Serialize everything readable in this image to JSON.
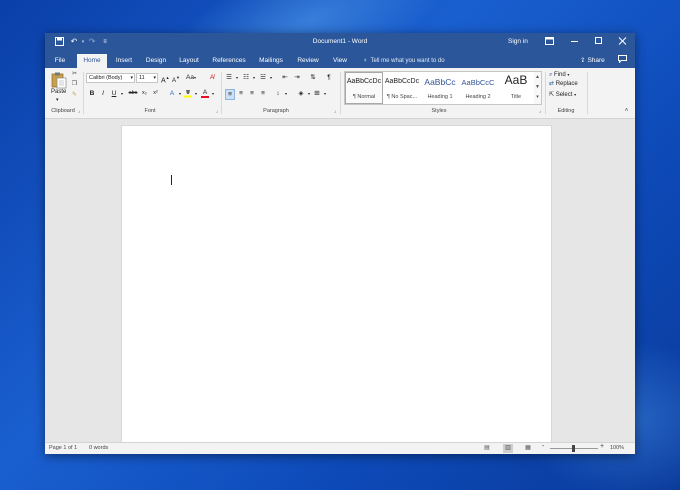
{
  "window": {
    "title": "Document1  -  Word",
    "sign_in": "Sign in"
  },
  "quick_access": {
    "save_icon": "save-icon",
    "undo_icon": "undo-icon",
    "redo_icon": "redo-icon",
    "customize_icon": "customize-icon"
  },
  "tabs": [
    {
      "label": "File"
    },
    {
      "label": "Home"
    },
    {
      "label": "Insert"
    },
    {
      "label": "Design"
    },
    {
      "label": "Layout"
    },
    {
      "label": "References"
    },
    {
      "label": "Mailings"
    },
    {
      "label": "Review"
    },
    {
      "label": "View"
    }
  ],
  "tell_me": "Tell me what you want to do",
  "share": "Share",
  "ribbon": {
    "clipboard": {
      "label": "Clipboard",
      "paste": "Paste"
    },
    "font": {
      "label": "Font",
      "font_name": "Calibri (Body)",
      "font_size": "11",
      "bold": "B",
      "italic": "I",
      "underline": "U",
      "strike": "abc",
      "subscript": "x₂",
      "superscript": "x²",
      "grow": "A",
      "shrink": "A",
      "case": "Aa",
      "font_color": "A"
    },
    "paragraph": {
      "label": "Paragraph",
      "pilcrow": "¶"
    },
    "styles": {
      "label": "Styles",
      "items": [
        {
          "preview": "AaBbCcDc",
          "name": "¶ Normal"
        },
        {
          "preview": "AaBbCcDc",
          "name": "¶ No Spac..."
        },
        {
          "preview": "AaBbCc",
          "name": "Heading 1"
        },
        {
          "preview": "AaBbCcC",
          "name": "Heading 2"
        },
        {
          "preview": "AaB",
          "name": "Title"
        }
      ]
    },
    "editing": {
      "label": "Editing",
      "find": "Find",
      "replace": "Replace",
      "select": "Select"
    }
  },
  "status": {
    "page": "Page 1 of 1",
    "words": "0 words",
    "zoom_minus": "-",
    "zoom_plus": "+",
    "zoom": "100%"
  },
  "colors": {
    "accent": "#2b579a",
    "ribbon_bg": "#f3f3f3",
    "highlight_yellow": "#ffff00",
    "font_red": "#e81123"
  }
}
